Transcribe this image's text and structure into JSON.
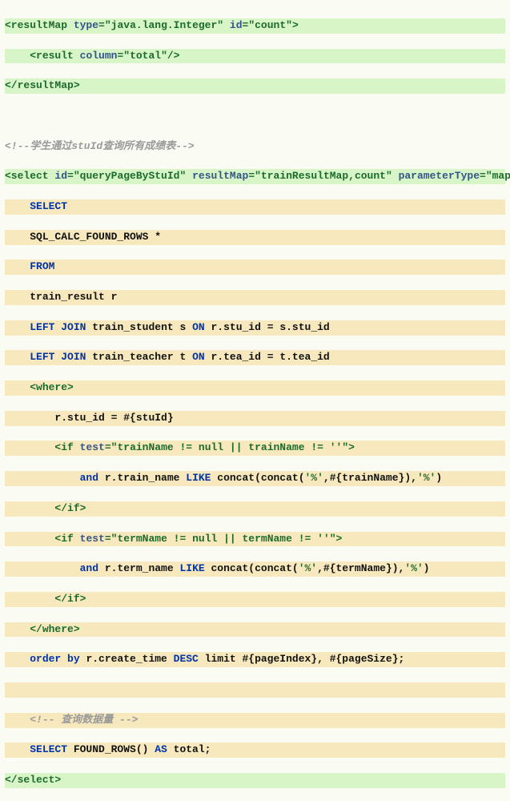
{
  "resultMap": {
    "open1": "<resultMap",
    "typeAttr": "type",
    "typeVal": "\"java.lang.Integer\"",
    "idAttr": "id",
    "idVal": "\"count\"",
    "close1": ">",
    "resultOpen": "<result",
    "columnAttr": "column",
    "columnVal": "\"total\"",
    "selfClose": "/>",
    "close2": "</resultMap>"
  },
  "comment1": "<!--学生通过stuId查询所有成绩表-->",
  "select": {
    "open": "<select",
    "idAttr": "id",
    "idVal": "\"queryPageByStuId\"",
    "rmAttr": "resultMap",
    "rmVal": "\"trainResultMap,count\"",
    "ptAttr": "parameterType",
    "ptVal": "\"map\"",
    "gt": ">",
    "close": "</select>"
  },
  "sql": {
    "selectKw": "SELECT",
    "row1": "SQL_CALC_FOUND_ROWS *",
    "fromKw": "FROM",
    "row3": "train_result r",
    "lj": "LEFT JOIN",
    "on": "ON",
    "t1a": "train_student s ",
    "t1b": "r.stu_id = s.stu_id",
    "t2a": "train_teacher t ",
    "t2b": "r.tea_id = t.tea_id"
  },
  "where": {
    "open": "<where>",
    "close": "</where>",
    "cond": "r.stu_id = #{stuId}"
  },
  "if1": {
    "open": "<if",
    "testAttr": "test",
    "testVal": "\"trainName != null || trainName != ''\"",
    "gt": ">",
    "andKw": "and ",
    "body1": "r.train_name ",
    "likeKw": "LIKE ",
    "body2": "concat(concat(",
    "lit1": "'%'",
    "mid": ",#{trainName}),",
    "lit2": "'%'",
    "tail": ")",
    "close": "</if>"
  },
  "if2": {
    "open": "<if",
    "testAttr": "test",
    "testVal": "\"termName != null || termName != ''\"",
    "gt": ">",
    "andKw": "and ",
    "body1": "r.term_name ",
    "likeKw": "LIKE ",
    "body2": "concat(concat(",
    "lit1": "'%'",
    "mid": ",#{termName}),",
    "lit2": "'%'",
    "tail": ")",
    "close": "</if>"
  },
  "order": {
    "orderKw": "order by ",
    "col": "r.create_time ",
    "descKw": "DESC ",
    "rest": "limit #{pageIndex}, #{pageSize};"
  },
  "comment2": "<!-- 查询数据量 -->",
  "final": {
    "selectKw": "SELECT ",
    "body1": "FOUND_ROWS() ",
    "asKw": "AS ",
    "body2": "total;"
  }
}
